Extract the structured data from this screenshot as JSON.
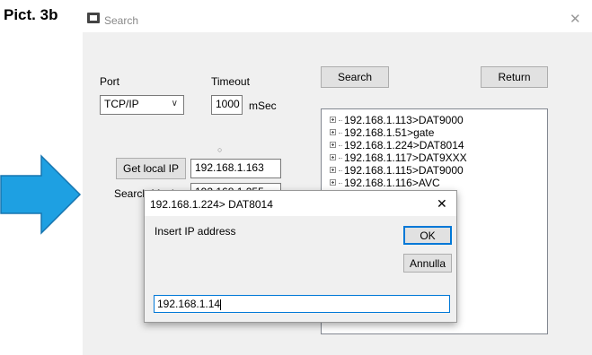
{
  "caption": "Pict. 3b",
  "window": {
    "title": "Search",
    "close_glyph": "✕",
    "icon": "app-window-icon"
  },
  "form": {
    "port_label": "Port",
    "port_value": "TCP/IP",
    "timeout_label": "Timeout",
    "timeout_value": "1000",
    "timeout_unit": "mSec",
    "get_local_ip_label": "Get local IP",
    "local_ip_value": "192.168.1.163",
    "search_mask_label": "Search Mask",
    "search_mask_value": "192.168.1.255",
    "search_label": "Search",
    "return_label": "Return"
  },
  "device_tree": [
    "192.168.1.113>DAT9000",
    "192.168.1.51>gate",
    "192.168.1.224>DAT8014",
    "192.168.1.117>DAT9XXX",
    "192.168.1.115>DAT9000",
    "192.168.1.116>AVC"
  ],
  "dialog": {
    "title": "192.168.1.224> DAT8014",
    "close_glyph": "✕",
    "prompt": "Insert IP address",
    "ok_label": "OK",
    "cancel_label": "Annulla",
    "ip_value": "192.168.1.14"
  },
  "colors": {
    "arrow_fill": "#1ea0e2",
    "arrow_stroke": "#1775b0",
    "window_bg": "#f0f0f0",
    "ok_border": "#0078d7",
    "input_focus_border": "#0078d7"
  }
}
